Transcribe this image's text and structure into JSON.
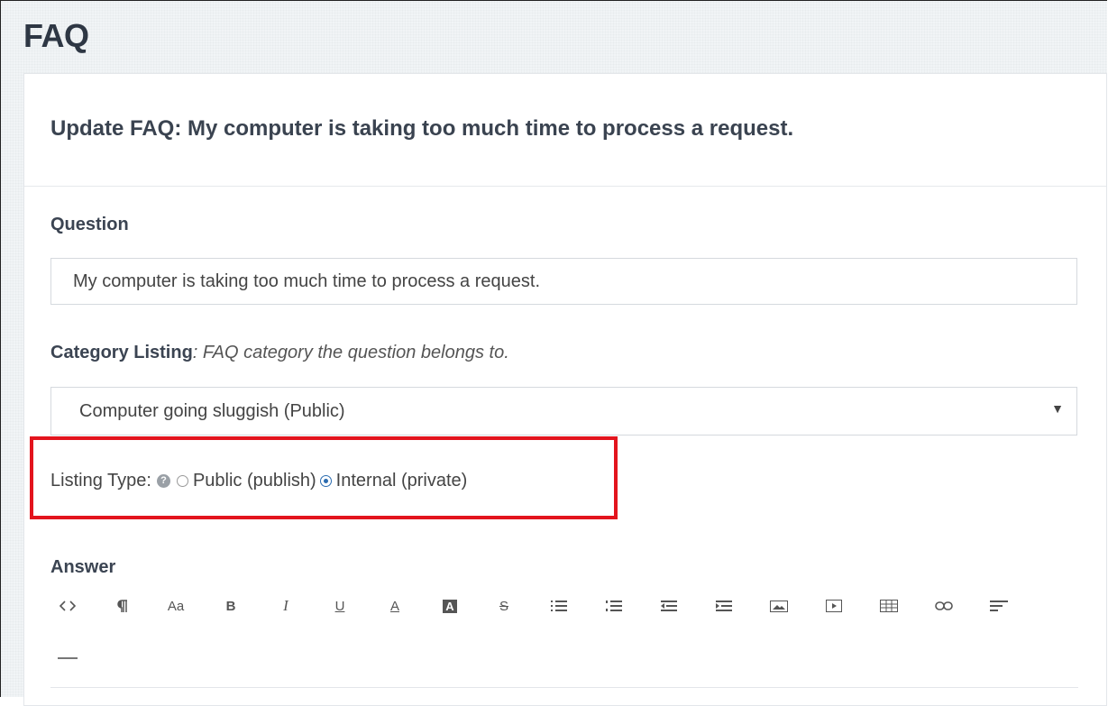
{
  "page": {
    "title": "FAQ"
  },
  "panel": {
    "title": "Update FAQ: My computer is taking too much time to process a request."
  },
  "question": {
    "label": "Question",
    "value": "My computer is taking too much time to process a request."
  },
  "category": {
    "label": "Category Listing",
    "separator": ": ",
    "help": "FAQ category the question belongs to.",
    "selected": "Computer going sluggish (Public)"
  },
  "listing_type": {
    "label": "Listing Type:",
    "help_icon": "question-circle",
    "options": [
      {
        "label": "Public (publish)",
        "checked": false
      },
      {
        "label": "Internal (private)",
        "checked": true
      }
    ]
  },
  "answer": {
    "label": "Answer",
    "toolbar": [
      {
        "name": "code-view",
        "glyph": "<>"
      },
      {
        "name": "paragraph",
        "glyph": "¶"
      },
      {
        "name": "font-size",
        "glyph": "Aa"
      },
      {
        "name": "bold",
        "glyph": "B"
      },
      {
        "name": "italic",
        "glyph": "I"
      },
      {
        "name": "underline",
        "glyph": "U"
      },
      {
        "name": "font-color",
        "glyph": "A"
      },
      {
        "name": "background-color",
        "glyph": "A"
      },
      {
        "name": "strikethrough",
        "glyph": "S"
      },
      {
        "name": "unordered-list",
        "glyph": ""
      },
      {
        "name": "ordered-list",
        "glyph": ""
      },
      {
        "name": "outdent",
        "glyph": ""
      },
      {
        "name": "indent",
        "glyph": ""
      },
      {
        "name": "image",
        "glyph": ""
      },
      {
        "name": "video",
        "glyph": ""
      },
      {
        "name": "table",
        "glyph": ""
      },
      {
        "name": "link",
        "glyph": ""
      },
      {
        "name": "align",
        "glyph": ""
      },
      {
        "name": "horizontal-rule",
        "glyph": ""
      }
    ]
  },
  "colors": {
    "highlight": "#e3141d",
    "radio_checked": "#2b6cb0",
    "title": "#2e3744"
  }
}
